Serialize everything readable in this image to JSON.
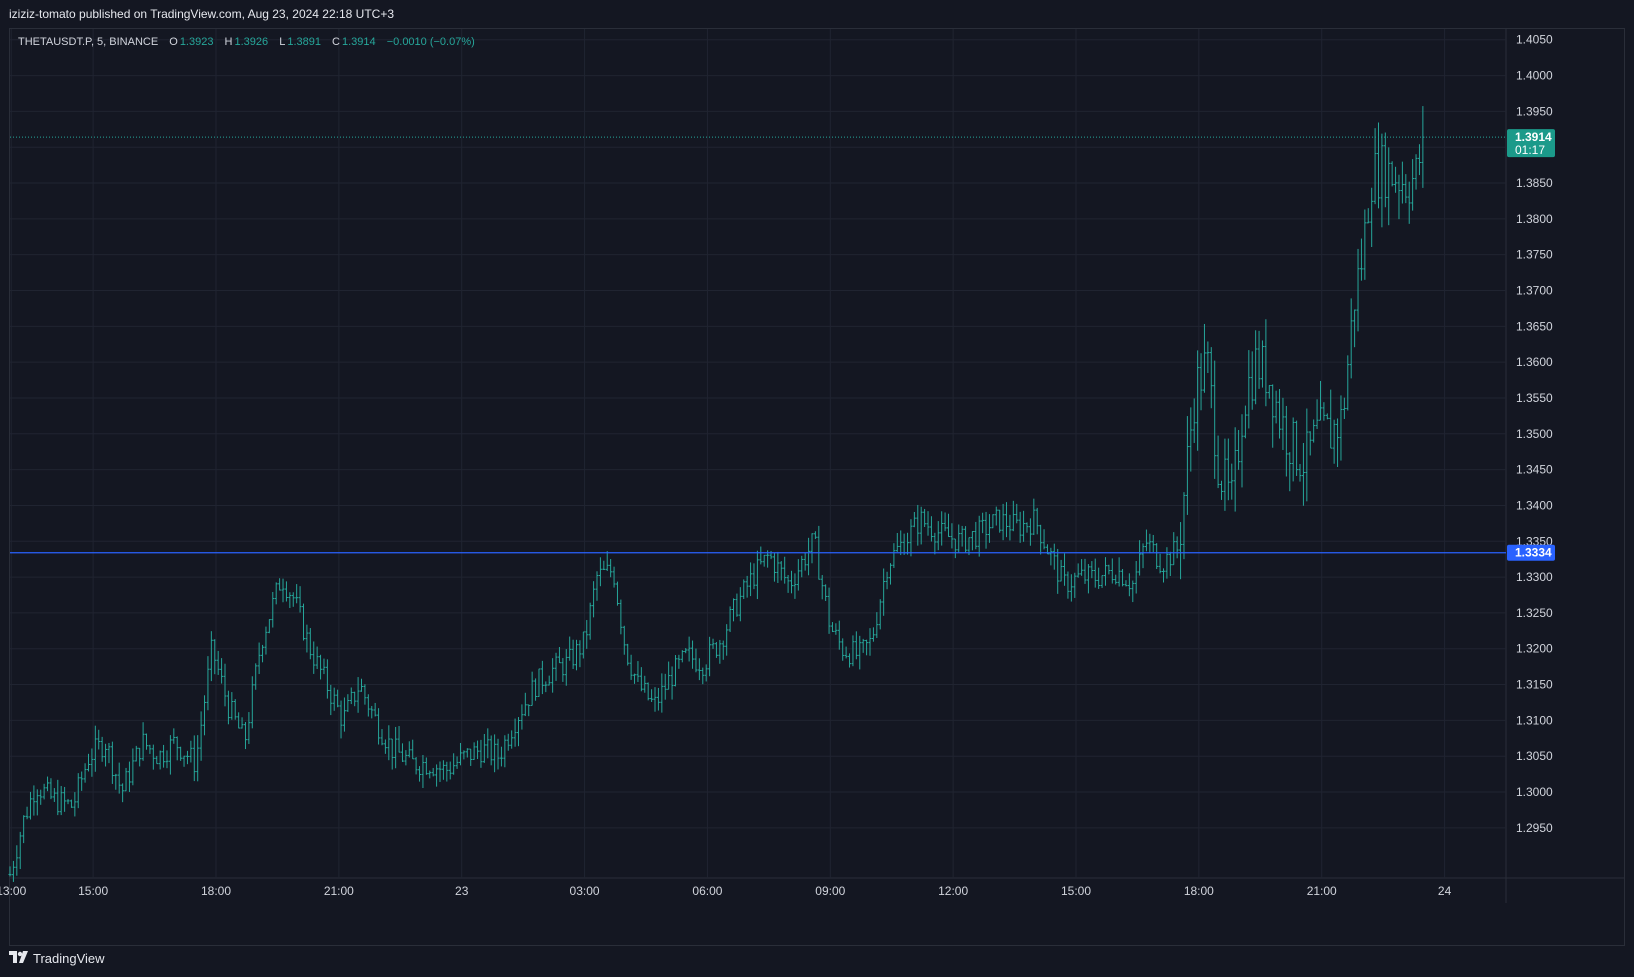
{
  "header": {
    "publish_text": "iziziz-tomato published on TradingView.com, Aug 23, 2024 22:18 UTC+3"
  },
  "legend": {
    "symbol": "THETAUSDT.P, 5, BINANCE",
    "o_label": "O",
    "o_value": "1.3923",
    "h_label": "H",
    "h_value": "1.3926",
    "l_label": "L",
    "l_value": "1.3891",
    "c_label": "C",
    "c_value": "1.3914",
    "change": "−0.0010 (−0.07%)"
  },
  "footer": {
    "brand": "TradingView",
    "logo_icon": "tradingview-logo-icon"
  },
  "colors": {
    "background": "#141722",
    "grid": "#202431",
    "bar": "#26a69a",
    "hline": "#2962ff",
    "price_badge": "#1b9a8a",
    "level_badge": "#2962ff",
    "text": "#d1d4dc"
  },
  "chart_data": {
    "type": "ohlc",
    "symbol": "THETAUSDT.P",
    "interval": "5",
    "exchange": "BINANCE",
    "ylim": [
      1.288,
      1.4065
    ],
    "y_ticks": [
      "1.4050",
      "1.4000",
      "1.3950",
      "1.3900",
      "1.3850",
      "1.3800",
      "1.3750",
      "1.3700",
      "1.3650",
      "1.3600",
      "1.3550",
      "1.3500",
      "1.3450",
      "1.3400",
      "1.3350",
      "1.3300",
      "1.3250",
      "1.3200",
      "1.3150",
      "1.3100",
      "1.3050",
      "1.3000",
      "1.2950"
    ],
    "x_ticks": [
      "13:00",
      "15:00",
      "18:00",
      "21:00",
      "23",
      "03:00",
      "06:00",
      "09:00",
      "12:00",
      "15:00",
      "18:00",
      "21:00",
      "24"
    ],
    "x_tick_hours": [
      13,
      15,
      18,
      21,
      24,
      27,
      30,
      33,
      36,
      39,
      42,
      45,
      48
    ],
    "x_range_hours": [
      12.97,
      49.5
    ],
    "current_price": {
      "label": "1.3914",
      "timer": "01:17"
    },
    "horizontal_line": {
      "label": "1.3334"
    },
    "anchors": [
      [
        12.97,
        1.2885
      ],
      [
        13.3,
        1.296
      ],
      [
        13.6,
        1.301
      ],
      [
        14.0,
        1.299
      ],
      [
        14.5,
        1.298
      ],
      [
        14.9,
        1.305
      ],
      [
        15.3,
        1.307
      ],
      [
        15.7,
        1.3
      ],
      [
        16.2,
        1.307
      ],
      [
        16.6,
        1.305
      ],
      [
        17.0,
        1.307
      ],
      [
        17.5,
        1.304
      ],
      [
        17.9,
        1.32
      ],
      [
        18.3,
        1.312
      ],
      [
        18.7,
        1.307
      ],
      [
        19.1,
        1.321
      ],
      [
        19.6,
        1.33
      ],
      [
        19.9,
        1.327
      ],
      [
        20.3,
        1.32
      ],
      [
        20.7,
        1.315
      ],
      [
        21.1,
        1.31
      ],
      [
        21.5,
        1.315
      ],
      [
        21.9,
        1.31
      ],
      [
        22.3,
        1.306
      ],
      [
        22.8,
        1.304
      ],
      [
        23.2,
        1.304
      ],
      [
        23.6,
        1.303
      ],
      [
        24.1,
        1.305
      ],
      [
        24.5,
        1.306
      ],
      [
        24.9,
        1.305
      ],
      [
        25.3,
        1.31
      ],
      [
        25.8,
        1.315
      ],
      [
        26.2,
        1.317
      ],
      [
        26.6,
        1.318
      ],
      [
        27.0,
        1.321
      ],
      [
        27.3,
        1.33
      ],
      [
        27.7,
        1.331
      ],
      [
        28.0,
        1.32
      ],
      [
        28.3,
        1.315
      ],
      [
        28.7,
        1.312
      ],
      [
        29.1,
        1.316
      ],
      [
        29.5,
        1.319
      ],
      [
        29.9,
        1.318
      ],
      [
        30.3,
        1.321
      ],
      [
        30.7,
        1.326
      ],
      [
        31.1,
        1.33
      ],
      [
        31.5,
        1.333
      ],
      [
        32.0,
        1.329
      ],
      [
        32.3,
        1.332
      ],
      [
        32.6,
        1.335
      ],
      [
        33.0,
        1.323
      ],
      [
        33.3,
        1.32
      ],
      [
        33.7,
        1.319
      ],
      [
        34.0,
        1.321
      ],
      [
        34.4,
        1.332
      ],
      [
        34.8,
        1.335
      ],
      [
        35.2,
        1.338
      ],
      [
        35.7,
        1.336
      ],
      [
        36.2,
        1.335
      ],
      [
        36.6,
        1.336
      ],
      [
        37.1,
        1.338
      ],
      [
        37.6,
        1.337
      ],
      [
        38.0,
        1.338
      ],
      [
        38.3,
        1.334
      ],
      [
        38.7,
        1.329
      ],
      [
        39.1,
        1.33
      ],
      [
        39.5,
        1.33
      ],
      [
        40.0,
        1.331
      ],
      [
        40.4,
        1.329
      ],
      [
        40.7,
        1.335
      ],
      [
        41.1,
        1.332
      ],
      [
        41.5,
        1.334
      ],
      [
        41.9,
        1.356
      ],
      [
        42.2,
        1.36
      ],
      [
        42.5,
        1.345
      ],
      [
        42.8,
        1.34
      ],
      [
        43.1,
        1.355
      ],
      [
        43.4,
        1.36
      ],
      [
        43.7,
        1.358
      ],
      [
        44.0,
        1.352
      ],
      [
        44.3,
        1.348
      ],
      [
        44.6,
        1.346
      ],
      [
        44.9,
        1.35
      ],
      [
        45.2,
        1.35
      ],
      [
        45.5,
        1.352
      ],
      [
        45.8,
        1.369
      ],
      [
        46.0,
        1.375
      ],
      [
        46.2,
        1.386
      ],
      [
        46.5,
        1.387
      ],
      [
        46.8,
        1.386
      ],
      [
        47.1,
        1.385
      ],
      [
        47.3,
        1.386
      ],
      [
        47.5,
        1.3914
      ]
    ]
  }
}
